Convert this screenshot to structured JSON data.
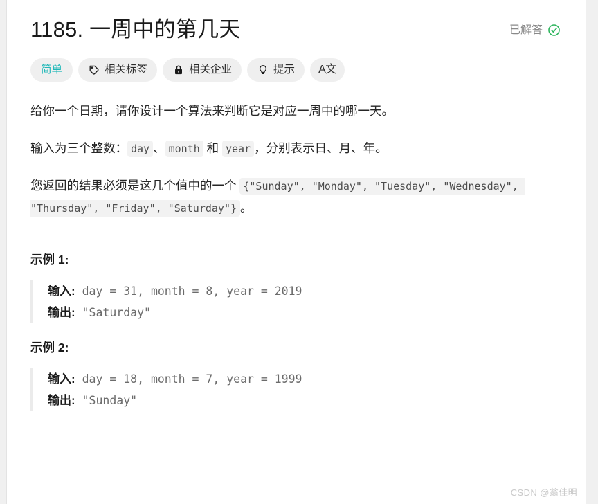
{
  "header": {
    "title": "1185. 一周中的第几天",
    "status_label": "已解答",
    "status_icon": "check-circle-icon",
    "status_color": "#2db55d"
  },
  "chips": [
    {
      "label": "简单",
      "icon": null,
      "kind": "difficulty",
      "color": "#21b8b8"
    },
    {
      "label": "相关标签",
      "icon": "tag-icon",
      "kind": "topics"
    },
    {
      "label": "相关企业",
      "icon": "lock-icon",
      "kind": "companies"
    },
    {
      "label": "提示",
      "icon": "lightbulb-icon",
      "kind": "hints"
    },
    {
      "label": "A文",
      "icon": "translate-icon",
      "kind": "language"
    }
  ],
  "description": {
    "p1": "给你一个日期，请你设计一个算法来判断它是对应一周中的哪一天。",
    "p2_before": "输入为三个整数：",
    "p2_code1": "day",
    "p2_sep1": "、",
    "p2_code2": "month",
    "p2_mid": " 和 ",
    "p2_code3": "year",
    "p2_after": "，分别表示日、月、年。",
    "p3_before": "您返回的结果必须是这几个值中的一个 ",
    "p3_code": "{\"Sunday\", \"Monday\", \"Tuesday\", \"Wednesday\", \"Thursday\", \"Friday\", \"Saturday\"}",
    "p3_after": "。"
  },
  "examples": [
    {
      "title": "示例 1:",
      "input_label": "输入:",
      "input_value": " day = 31, month = 8, year = 2019",
      "output_label": "输出:",
      "output_value": " \"Saturday\""
    },
    {
      "title": "示例 2:",
      "input_label": "输入:",
      "input_value": " day = 18, month = 7, year = 1999",
      "output_label": "输出:",
      "output_value": " \"Sunday\""
    }
  ],
  "watermark": "CSDN @翁佳明"
}
